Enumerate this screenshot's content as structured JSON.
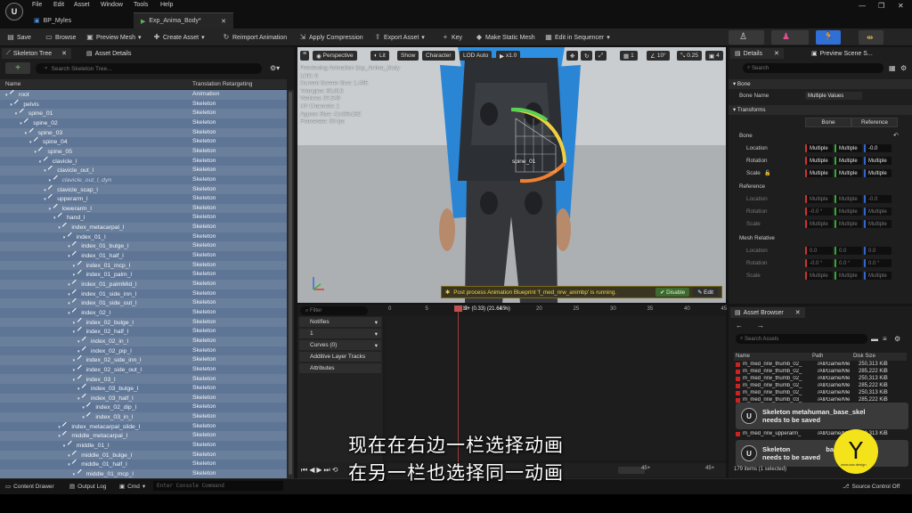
{
  "menu": [
    "File",
    "Edit",
    "Asset",
    "Window",
    "Tools",
    "Help"
  ],
  "tabs": [
    {
      "label": "BP_Myles"
    },
    {
      "label": "Exp_Anima_Body*"
    }
  ],
  "toolbar": {
    "save": "Save",
    "browse": "Browse",
    "preview_mesh": "Preview Mesh",
    "create_asset": "Create Asset",
    "reimport": "Reimport Animation",
    "apply_compression": "Apply Compression",
    "export_asset": "Export Asset",
    "key": "Key",
    "make_static_mesh": "Make Static Mesh",
    "edit_in_sequencer": "Edit in Sequencer"
  },
  "skeleton_tree": {
    "tab_label": "Skeleton Tree",
    "asset_details_tab": "Asset Details",
    "add_label": "+",
    "search_placeholder": "Search Skeleton Tree...",
    "col_name": "Name",
    "col_retarget": "Translation Retargeting",
    "rows": [
      {
        "name": "root",
        "mode": "Animation",
        "depth": 0
      },
      {
        "name": "pelvis",
        "mode": "Skeleton",
        "depth": 1
      },
      {
        "name": "spine_01",
        "mode": "Skeleton",
        "depth": 2
      },
      {
        "name": "spine_02",
        "mode": "Skeleton",
        "depth": 3
      },
      {
        "name": "spine_03",
        "mode": "Skeleton",
        "depth": 4
      },
      {
        "name": "spine_04",
        "mode": "Skeleton",
        "depth": 5
      },
      {
        "name": "spine_05",
        "mode": "Skeleton",
        "depth": 6
      },
      {
        "name": "clavicle_l",
        "mode": "Skeleton",
        "depth": 7
      },
      {
        "name": "clavicle_out_l",
        "mode": "Skeleton",
        "depth": 8
      },
      {
        "name": "clavicle_out_l_dyn",
        "mode": "Skeleton",
        "depth": 9,
        "dim": true
      },
      {
        "name": "clavicle_scap_l",
        "mode": "Skeleton",
        "depth": 8
      },
      {
        "name": "upperarm_l",
        "mode": "Skeleton",
        "depth": 8
      },
      {
        "name": "lowerarm_l",
        "mode": "Skeleton",
        "depth": 9
      },
      {
        "name": "hand_l",
        "mode": "Skeleton",
        "depth": 10
      },
      {
        "name": "index_metacarpal_l",
        "mode": "Skeleton",
        "depth": 11
      },
      {
        "name": "index_01_l",
        "mode": "Skeleton",
        "depth": 12
      },
      {
        "name": "index_01_bulge_l",
        "mode": "Skeleton",
        "depth": 13
      },
      {
        "name": "index_01_half_l",
        "mode": "Skeleton",
        "depth": 13
      },
      {
        "name": "index_01_mcp_l",
        "mode": "Skeleton",
        "depth": 14
      },
      {
        "name": "index_01_palm_l",
        "mode": "Skeleton",
        "depth": 14
      },
      {
        "name": "index_01_palmMid_l",
        "mode": "Skeleton",
        "depth": 13
      },
      {
        "name": "index_01_side_inn_l",
        "mode": "Skeleton",
        "depth": 13
      },
      {
        "name": "index_01_side_out_l",
        "mode": "Skeleton",
        "depth": 13
      },
      {
        "name": "index_02_l",
        "mode": "Skeleton",
        "depth": 13
      },
      {
        "name": "index_02_bulge_l",
        "mode": "Skeleton",
        "depth": 14
      },
      {
        "name": "index_02_half_l",
        "mode": "Skeleton",
        "depth": 14
      },
      {
        "name": "index_02_in_l",
        "mode": "Skeleton",
        "depth": 15
      },
      {
        "name": "index_02_pip_l",
        "mode": "Skeleton",
        "depth": 15
      },
      {
        "name": "index_02_side_inn_l",
        "mode": "Skeleton",
        "depth": 14
      },
      {
        "name": "index_02_side_out_l",
        "mode": "Skeleton",
        "depth": 14
      },
      {
        "name": "index_03_l",
        "mode": "Skeleton",
        "depth": 14
      },
      {
        "name": "index_03_bulge_l",
        "mode": "Skeleton",
        "depth": 15
      },
      {
        "name": "index_03_half_l",
        "mode": "Skeleton",
        "depth": 15
      },
      {
        "name": "index_02_dip_l",
        "mode": "Skeleton",
        "depth": 16
      },
      {
        "name": "index_03_in_l",
        "mode": "Skeleton",
        "depth": 16
      },
      {
        "name": "index_metacarpal_slide_l",
        "mode": "Skeleton",
        "depth": 11
      },
      {
        "name": "middle_metacarpal_l",
        "mode": "Skeleton",
        "depth": 11
      },
      {
        "name": "middle_01_l",
        "mode": "Skeleton",
        "depth": 12
      },
      {
        "name": "middle_01_bulge_l",
        "mode": "Skeleton",
        "depth": 13
      },
      {
        "name": "middle_01_half_l",
        "mode": "Skeleton",
        "depth": 13
      },
      {
        "name": "middle_01_mcp_l",
        "mode": "Skeleton",
        "depth": 14
      }
    ]
  },
  "viewport": {
    "perspective": "Perspective",
    "lit": "Lit",
    "show": "Show",
    "character": "Character",
    "lod": "LOD Auto",
    "speed": "x1.0",
    "grid_snap": "1",
    "angle": "10°",
    "scale": "0.25",
    "cam_speed": "4",
    "info_lines": [
      "Previewing Animation Exp_Anima_Body",
      "LOD: 0",
      "Current Screen Size: 1.495",
      "Triangles: 60,816",
      "Vertices: 37,549",
      "UV Channels: 1",
      "Approx Size: 41x35x162",
      "Framerate: 30 fps"
    ],
    "bone_label": "spine_01",
    "notice_text": "Post process Animation Blueprint 'f_med_nrw_animbp' is running.",
    "disable_label": "Disable",
    "edit_label": "Edit"
  },
  "timeline": {
    "filter_placeholder": "Filter",
    "playhead_readout": "9+ (0.33) (21.64 %)",
    "ticks": [
      "0",
      "5",
      "10",
      "15",
      "20",
      "25",
      "30",
      "35",
      "40",
      "45"
    ],
    "tracks": [
      {
        "label": "Notifies"
      },
      {
        "label": "1"
      },
      {
        "label": "Curves (0)"
      },
      {
        "label": "Additive Layer Tracks"
      },
      {
        "label": "Attributes"
      }
    ],
    "range_start": "45+",
    "range_end": "45+"
  },
  "details": {
    "tab_label": "Details",
    "preview_tab": "Preview Scene S...",
    "search_placeholder": "Search",
    "section_bone": "Bone",
    "bone_name_label": "Bone Name",
    "bone_name_value": "Multiple Values",
    "section_transforms": "Transforms",
    "seg_bone": "Bone",
    "seg_reference": "Reference",
    "group_bone": "Bone",
    "group_reference": "Reference",
    "group_mesh_relative": "Mesh Relative",
    "location_label": "Location",
    "rotation_label": "Rotation",
    "scale_label": "Scale",
    "bone_location": [
      "Multiple",
      "Multiple",
      "-0.0"
    ],
    "bone_rotation": [
      "Multiple",
      "Multiple",
      "Multiple"
    ],
    "bone_scale": [
      "Multiple",
      "Multiple",
      "Multiple"
    ],
    "ref_location": [
      "Multiple",
      "Multiple",
      "-0.0"
    ],
    "ref_rotation": [
      "-0.0 °",
      "Multiple",
      "Multiple"
    ],
    "ref_scale": [
      "Multiple",
      "Multiple",
      "Multiple"
    ],
    "mesh_location": [
      "0.0",
      "0.0",
      "0.0"
    ],
    "mesh_rotation": [
      "-0.0 °",
      "0.0 °",
      "0.0 °"
    ],
    "mesh_scale": [
      "Multiple",
      "Multiple",
      "Multiple"
    ]
  },
  "asset_browser": {
    "tab_label": "Asset Browser",
    "search_placeholder": "Search Assets",
    "col_name": "Name",
    "col_path": "Path",
    "col_size": "Disk Size",
    "rows": [
      {
        "name": "m_med_nrw_thumb_02_",
        "path": "/All/Game/Me",
        "size": "250,313 KiB"
      },
      {
        "name": "m_med_nrw_thumb_02_",
        "path": "/All/Game/Me",
        "size": "285,222 KiB"
      },
      {
        "name": "m_med_nrw_thumb_02_",
        "path": "/All/Game/Me",
        "size": "250,313 KiB"
      },
      {
        "name": "m_med_nrw_thumb_02_",
        "path": "/All/Game/Me",
        "size": "285,222 KiB"
      },
      {
        "name": "m_med_nrw_thumb_02_",
        "path": "/All/Game/Me",
        "size": "250,313 KiB"
      },
      {
        "name": "m_med_nrw_thumb_03_",
        "path": "/All/Game/Me",
        "size": "285,222 KiB"
      },
      {
        "name": "m_med_nrw_upperarm_",
        "path": "/All/Game/Me",
        "size": "250,313 KiB"
      }
    ],
    "item_count": "179 items (1 selected)",
    "toast_title": "Skeleton metahuman_base_skel",
    "toast_sub": "needs to be saved",
    "toast2_title": "Skeleton",
    "toast2_suffix": "base_ske",
    "toast2_sub": "needs to be saved"
  },
  "statusbar": {
    "content_drawer": "Content Drawer",
    "output_log": "Output Log",
    "cmd": "Cmd",
    "console_placeholder": "Enter Console Command",
    "source_control": "Source Control Off"
  },
  "subtitles": {
    "line1": "现在在右边一栏选择动画",
    "line2": "在另一栏也选择同一动画"
  },
  "watermark": {
    "glyph": "Y",
    "text": "www.aov.design"
  },
  "colors": {
    "accent_blue": "#2f6fd6",
    "tree_bg": "#6a7f9c",
    "notice_yellow": "#f3d44a",
    "logo_yellow": "#f4e31a"
  }
}
